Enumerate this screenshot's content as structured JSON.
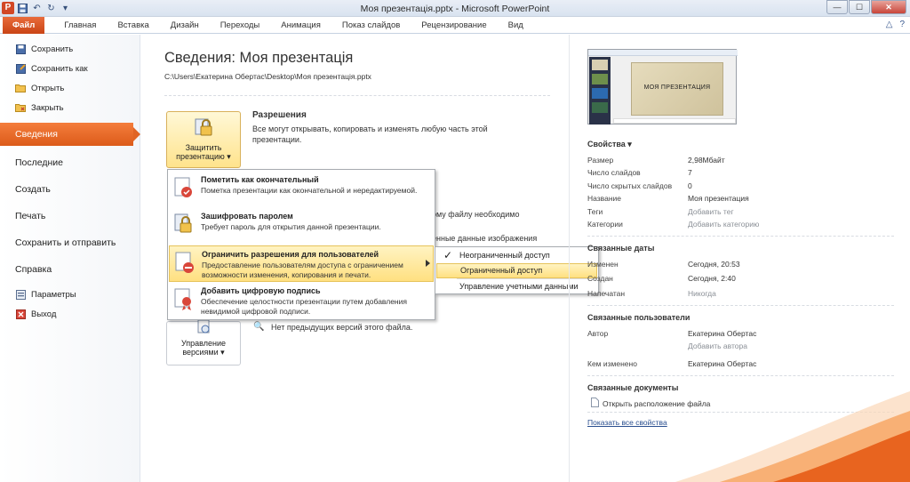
{
  "window": {
    "title": "Моя презентація.pptx  -  Microsoft PowerPoint",
    "app_logo": "P",
    "qat": [
      "save-icon",
      "undo-icon",
      "redo-icon"
    ],
    "controls": [
      "—",
      "☐",
      "✕"
    ]
  },
  "ribbon": {
    "tabs": [
      "Файл",
      "Главная",
      "Вставка",
      "Дизайн",
      "Переходы",
      "Анимация",
      "Показ слайдов",
      "Рецензирование",
      "Вид"
    ],
    "right_icons": [
      "△",
      "?"
    ]
  },
  "nav": {
    "small_top": [
      {
        "label": "Сохранить",
        "icon": "save-icon"
      },
      {
        "label": "Сохранить как",
        "icon": "save-as-icon"
      },
      {
        "label": "Открыть",
        "icon": "folder-open-icon"
      },
      {
        "label": "Закрыть",
        "icon": "folder-close-icon"
      }
    ],
    "active": "Сведения",
    "big": [
      "Последние",
      "Создать",
      "Печать",
      "Сохранить и отправить",
      "Справка"
    ],
    "small_bottom": [
      {
        "label": "Параметры",
        "icon": "options-icon"
      },
      {
        "label": "Выход",
        "icon": "exit-icon"
      }
    ]
  },
  "main": {
    "title": "Сведения: Моя презентація",
    "path": "C:\\Users\\Екатерина Обертас\\Desktop\\Моя презентація.pptx",
    "protect": {
      "button_line1": "Защитить",
      "button_line2": "презентацию ▾",
      "heading": "Разрешения",
      "text": "Все могут открывать, копировать и изменять любую часть этой презентации."
    },
    "hidden_text_1": "ому файлу необходимо",
    "hidden_text_2": "енные данные изображения",
    "versions": {
      "button_line1": "Управление",
      "button_line2": "версиями ▾",
      "text": "Нет предыдущих версий этого файла."
    }
  },
  "dropdown": {
    "items": [
      {
        "title": "Пометить как окончательный",
        "desc": "Пометка презентации как окончательной и нередактируемой."
      },
      {
        "title": "Зашифровать паролем",
        "desc": "Требует пароль для открытия данной презентации."
      },
      {
        "title": "Ограничить разрешения для пользователей",
        "desc": "Предоставление пользователям доступа с ограничением возможности изменения, копирования и печати."
      },
      {
        "title": "Добавить цифровую подпись",
        "desc": "Обеспечение целостности презентации путем добавления невидимой цифровой подписи."
      }
    ]
  },
  "submenu": {
    "items": [
      {
        "label": "Неограниченный доступ",
        "checked": true
      },
      {
        "label": "Ограниченный доступ",
        "highlighted": true
      },
      {
        "label": "Управление учетными данными"
      }
    ],
    "check": "✓"
  },
  "right": {
    "thumbnail_title": "МОЯ ПРЕЗЕНТАЦИЯ",
    "properties_title": "Свойства ▾",
    "properties": [
      {
        "label": "Размер",
        "value": "2,98Мбайт"
      },
      {
        "label": "Число слайдов",
        "value": "7"
      },
      {
        "label": "Число скрытых слайдов",
        "value": "0"
      },
      {
        "label": "Название",
        "value": "Моя презентация"
      },
      {
        "label": "Теги",
        "value": "Добавить тег",
        "muted": true
      },
      {
        "label": "Категории",
        "value": "Добавить категорию",
        "muted": true
      }
    ],
    "dates_title": "Связанные даты",
    "dates": [
      {
        "label": "Изменен",
        "value": "Сегодня, 20:53"
      },
      {
        "label": "Создан",
        "value": "Сегодня, 2:40"
      },
      {
        "label": "Напечатан",
        "value": "Никогда",
        "muted": true
      }
    ],
    "people_title": "Связанные пользователи",
    "people": [
      {
        "label": "Автор",
        "value": "Екатерина Обертас"
      },
      {
        "label": "",
        "value": "Добавить автора",
        "muted": true
      },
      {
        "label": "Кем изменено",
        "value": "Екатерина Обертас"
      }
    ],
    "docs_title": "Связанные документы",
    "open_location": "Открыть расположение файла",
    "show_all": "Показать все свойства"
  }
}
